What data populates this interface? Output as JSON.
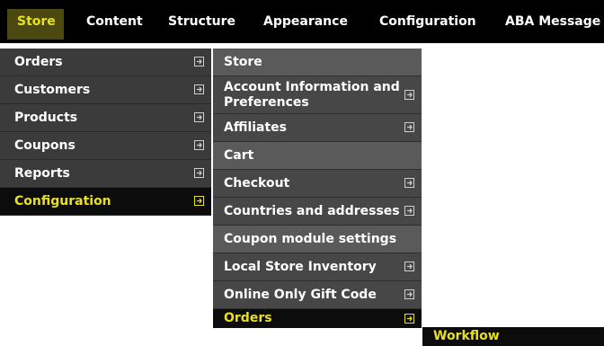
{
  "topbar": {
    "items": [
      {
        "label": "Store"
      },
      {
        "label": "Content"
      },
      {
        "label": "Structure"
      },
      {
        "label": "Appearance"
      },
      {
        "label": "Configuration"
      },
      {
        "label": "ABA Message"
      }
    ]
  },
  "store_menu": {
    "items": [
      {
        "label": "Orders"
      },
      {
        "label": "Customers"
      },
      {
        "label": "Products"
      },
      {
        "label": "Coupons"
      },
      {
        "label": "Reports"
      },
      {
        "label": "Configuration"
      }
    ]
  },
  "configuration_menu": {
    "items": [
      {
        "label": "Store"
      },
      {
        "label": "Account Information and Preferences"
      },
      {
        "label": "Affiliates"
      },
      {
        "label": "Cart"
      },
      {
        "label": "Checkout"
      },
      {
        "label": "Countries and addresses"
      },
      {
        "label": "Coupon module settings"
      },
      {
        "label": "Local Store Inventory"
      },
      {
        "label": "Online Only Gift Code"
      },
      {
        "label": "Orders"
      }
    ]
  },
  "orders_menu": {
    "items": [
      {
        "label": "Workflow"
      }
    ]
  },
  "icons": {
    "submenu": "expand-submenu-icon"
  },
  "colors": {
    "bar": "#000000",
    "menu": "#3b3b3b",
    "active_text": "#e8e020",
    "text": "#ffffff"
  }
}
